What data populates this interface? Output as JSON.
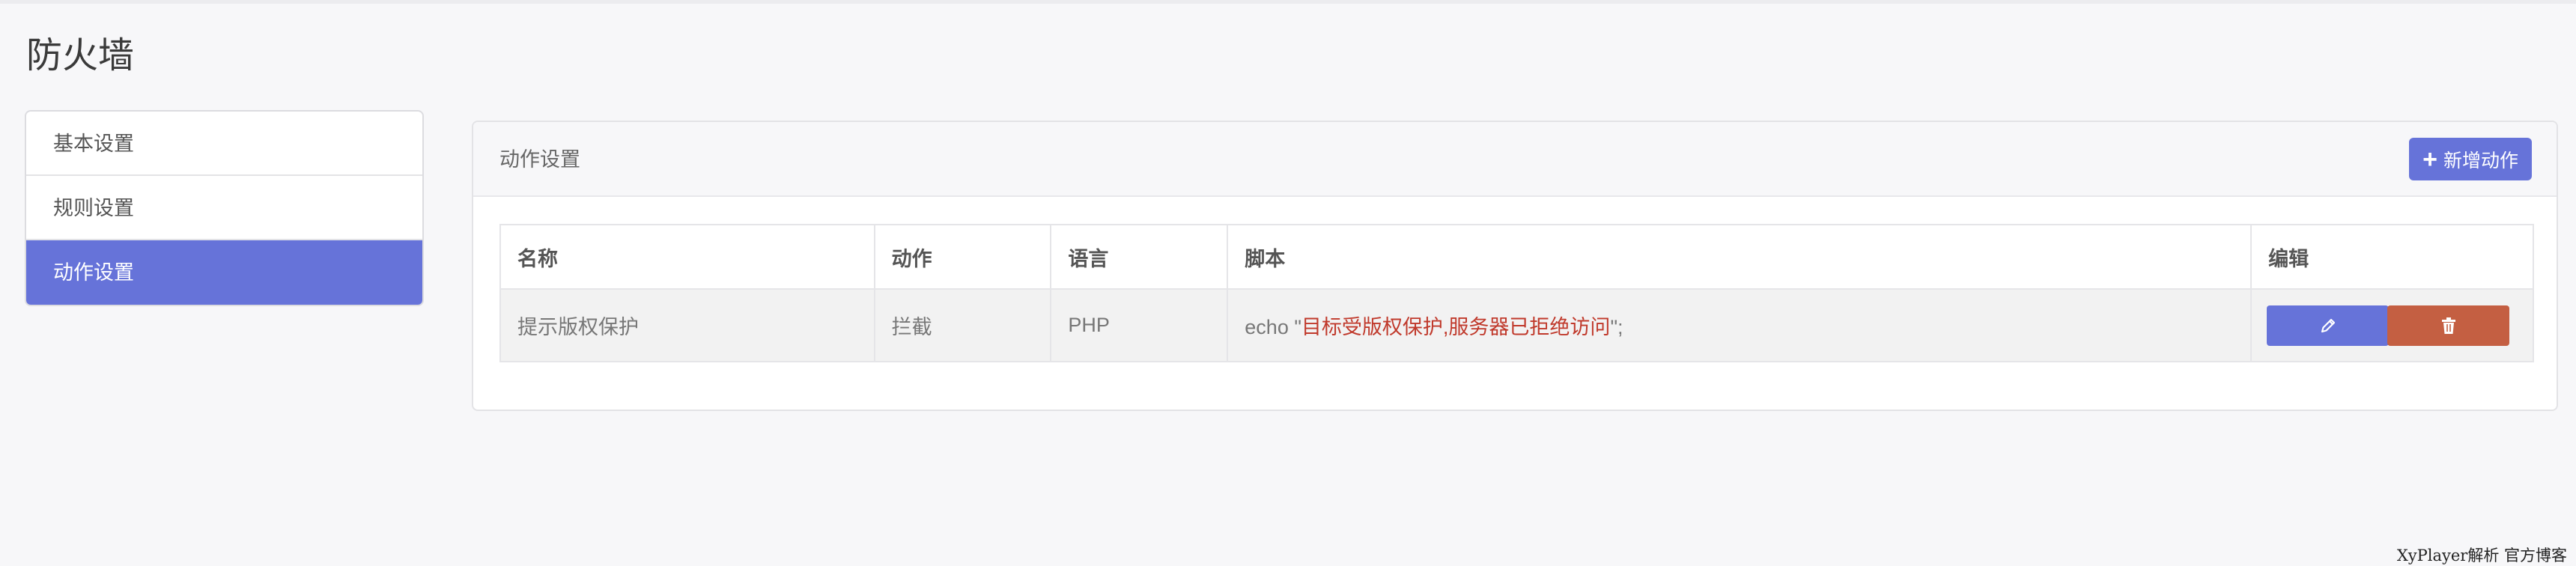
{
  "page": {
    "title": "防火墙"
  },
  "sidebar": {
    "items": [
      {
        "label": "基本设置",
        "active": false
      },
      {
        "label": "规则设置",
        "active": false
      },
      {
        "label": "动作设置",
        "active": true
      }
    ]
  },
  "panel": {
    "title": "动作设置",
    "add_button": {
      "label": "新增动作",
      "icon": "plus-icon"
    }
  },
  "table": {
    "headers": [
      "名称",
      "动作",
      "语言",
      "脚本",
      "编辑"
    ],
    "rows": [
      {
        "name": "提示版权保护",
        "action": "拦截",
        "language": "PHP",
        "script_prefix": "echo \"",
        "script_string": "目标受版权保护,服务器已拒绝访问",
        "script_suffix": "\";",
        "edit_icon": "pencil-icon",
        "delete_icon": "trash-icon"
      }
    ]
  },
  "colors": {
    "primary": "#6673d9",
    "danger": "#c45f42",
    "script_string": "#c0392b"
  },
  "footer": {
    "text": "XyPlayer解析 官方博客"
  }
}
